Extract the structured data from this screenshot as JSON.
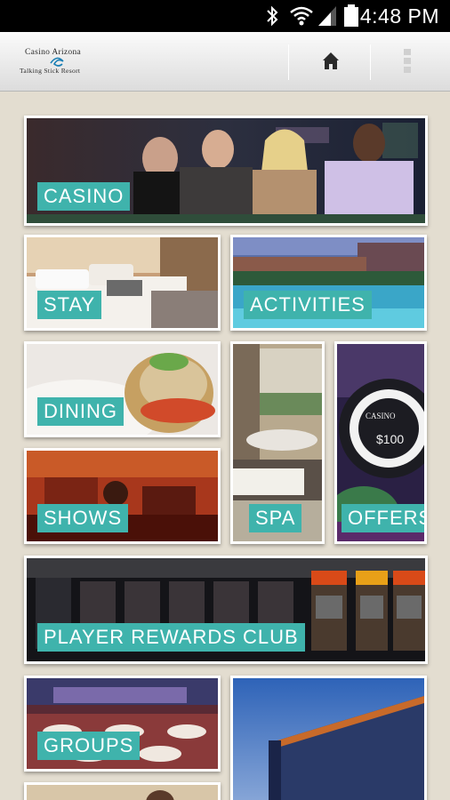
{
  "status_bar": {
    "time": "4:48 PM",
    "icons": [
      "bluetooth-icon",
      "wifi-icon",
      "signal-icon",
      "battery-icon"
    ]
  },
  "header": {
    "logo_line1": "Casino Arizona",
    "logo_line2": "Talking Stick Resort",
    "home_icon": "home-icon",
    "menu_icon": "overflow-menu-icon"
  },
  "colors": {
    "label_bg": "#3fb3ac",
    "page_bg": "#e3ddd0",
    "tile_border": "#ffffff"
  },
  "tiles": {
    "casino": {
      "label": "CASINO"
    },
    "stay": {
      "label": "STAY"
    },
    "activities": {
      "label": "ACTIVITIES"
    },
    "dining": {
      "label": "DINING"
    },
    "shows": {
      "label": "SHOWS"
    },
    "spa": {
      "label": "SPA"
    },
    "offers": {
      "label": "OFFERS",
      "chip_text": "CASINO",
      "chip_value": "$100"
    },
    "player_rewards": {
      "label": "PLAYER REWARDS CLUB"
    },
    "groups": {
      "label": "GROUPS"
    }
  }
}
